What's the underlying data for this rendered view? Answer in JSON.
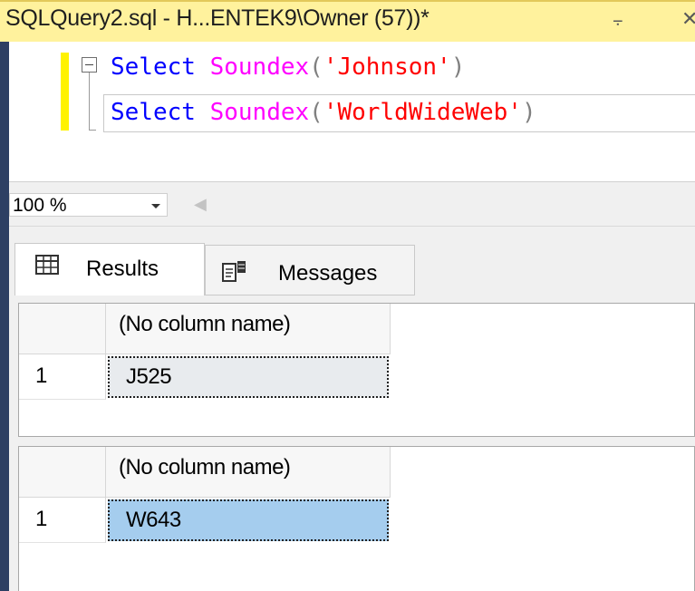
{
  "titlebar": {
    "title": "SQLQuery2.sql - H...ENTEK9\\Owner (57))*",
    "pin_icon": "pin-icon",
    "close_icon": "close-icon"
  },
  "editor": {
    "lines": [
      {
        "keyword": "Select",
        "function": "Soundex",
        "open": "(",
        "argument": "'Johnson'",
        "close": ")"
      },
      {
        "keyword": "Select",
        "function": "Soundex",
        "open": "(",
        "argument": "'WorldWideWeb'",
        "close": ")"
      }
    ],
    "colors": {
      "keyword": "#0000ff",
      "function": "#ff00ff",
      "string": "#ff0000",
      "punct": "#808080"
    }
  },
  "zoom": {
    "value": "100 %"
  },
  "results": {
    "tabs": [
      {
        "label": "Results",
        "icon": "grid-icon",
        "active": true
      },
      {
        "label": "Messages",
        "icon": "messages-icon",
        "active": false
      }
    ],
    "grids": [
      {
        "column_header": "(No column name)",
        "row_number": "1",
        "value": "J525",
        "selected": false
      },
      {
        "column_header": "(No column name)",
        "row_number": "1",
        "value": "W643",
        "selected": true
      }
    ]
  }
}
